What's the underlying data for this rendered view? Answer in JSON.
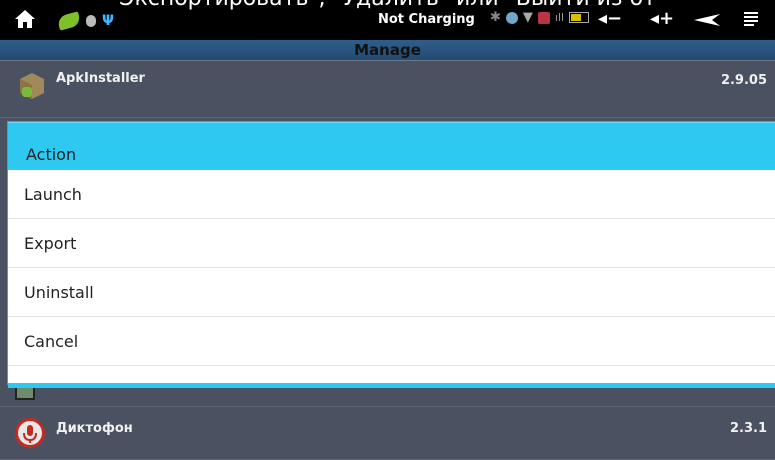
{
  "overlay_caption": "Экспортировать\", \"Удалить\" или \"Выйти из от",
  "status_bar": {
    "charging_text": "Not Charging",
    "icons": [
      "home-icon",
      "leaf-icon",
      "bug-icon",
      "usb-icon",
      "bluetooth-icon",
      "alarm-icon",
      "wifi-icon",
      "signal-icon",
      "battery-icon"
    ],
    "nav_buttons": [
      "volume-down-icon",
      "volume-up-icon",
      "back-icon",
      "menu-icon"
    ]
  },
  "title_bar": {
    "title": "Manage"
  },
  "list": {
    "items": [
      {
        "name": "ApkInstaller",
        "version": "2.9.05",
        "icon": "android-box-icon"
      },
      {
        "name": "Диктофон",
        "version": "2.3.1",
        "icon": "microphone-icon"
      }
    ]
  },
  "dialog": {
    "title": "Action",
    "options": [
      "Launch",
      "Export",
      "Uninstall",
      "Cancel"
    ],
    "accent_color": "#2ec9f0"
  }
}
